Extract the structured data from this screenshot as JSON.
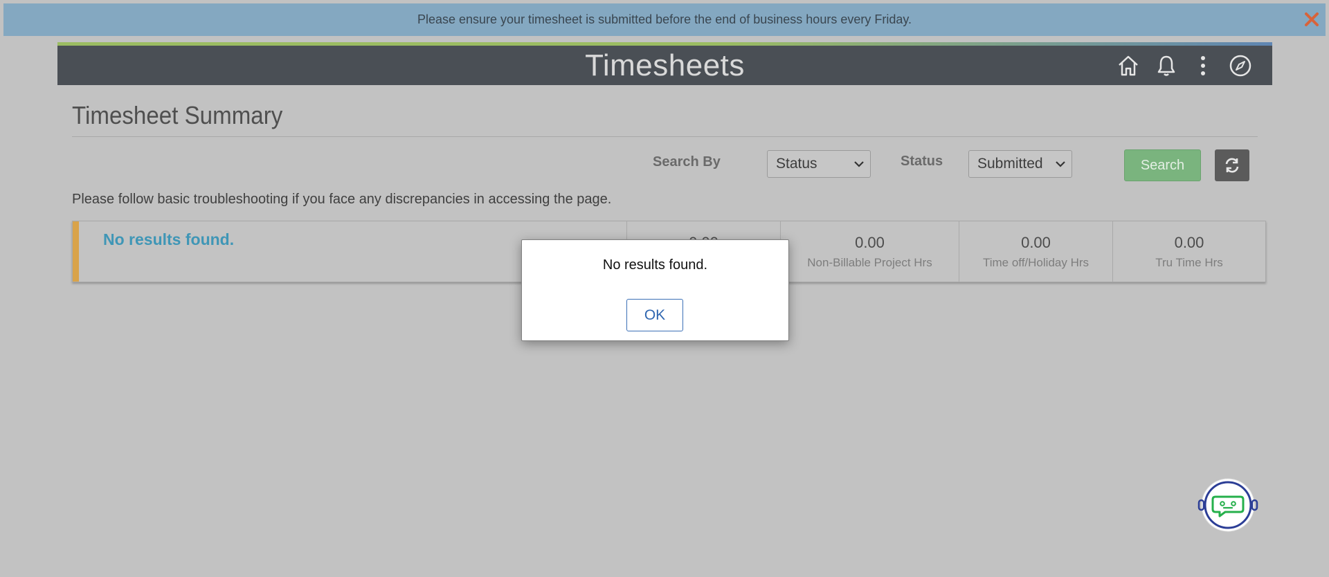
{
  "banner": {
    "message": "Please ensure your timesheet is submitted before the end of business hours every Friday.",
    "close_icon": "close-x-icon",
    "close_color": "#d8633a"
  },
  "header": {
    "title": "Timesheets",
    "icons": [
      "home-icon",
      "bell-icon",
      "more-vertical-icon",
      "compass-icon"
    ]
  },
  "page": {
    "title": "Timesheet Summary",
    "note": "Please follow basic troubleshooting if you face any discrepancies in accessing the page."
  },
  "search": {
    "search_by_label": "Search By",
    "search_by_value": "Status",
    "status_label": "Status",
    "status_value": "Submitted",
    "search_button": "Search",
    "refresh_icon": "refresh-icon"
  },
  "results": {
    "title": "No results found.",
    "metrics": [
      {
        "value": "0.00",
        "label": ""
      },
      {
        "value": "0.00",
        "label": "Non-Billable Project Hrs"
      },
      {
        "value": "0.00",
        "label": "Time off/Holiday Hrs"
      },
      {
        "value": "0.00",
        "label": "Tru Time Hrs"
      }
    ]
  },
  "dialog": {
    "message": "No results found.",
    "ok_label": "OK"
  },
  "chatbot": {
    "icon": "chatbot-icon"
  },
  "colors": {
    "header_bg": "#4a4f55",
    "banner_bg": "#84a8c1",
    "accent_orange": "#d9a34a",
    "search_green": "#7ab47e",
    "link_blue": "#3f96b6"
  }
}
